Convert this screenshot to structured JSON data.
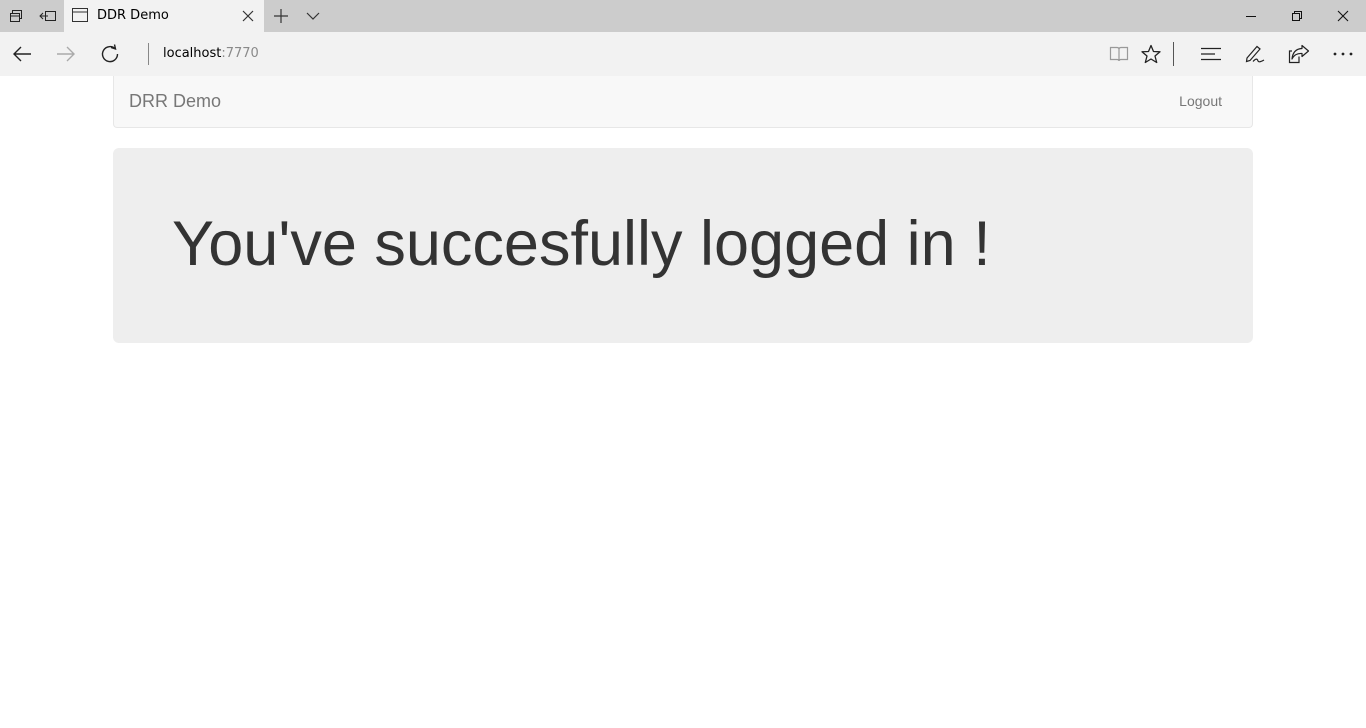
{
  "browser": {
    "tab": {
      "title": "DDR Demo"
    },
    "address": {
      "host": "localhost",
      "port": ":7770"
    }
  },
  "page": {
    "navbar": {
      "brand": "DRR Demo",
      "logout_label": "Logout"
    },
    "jumbotron": {
      "heading": "You've succesfully logged in !"
    }
  },
  "colors": {
    "tabstrip": "#cccccc",
    "chrome": "#f2f2f2",
    "navbar_bg": "#f8f8f8",
    "jumbotron_bg": "#eeeeee",
    "heading_text": "#333333",
    "muted_text": "#777777"
  },
  "icons": {
    "tab_strip_left": [
      "tab-previews-icon",
      "set-aside-tabs-icon"
    ],
    "tab": [
      "page-favicon-icon",
      "close-icon"
    ],
    "tab_strip_after": [
      "new-tab-plus-icon",
      "tab-list-chevron-icon"
    ],
    "window": [
      "minimize-icon",
      "restore-icon",
      "window-close-icon"
    ],
    "navigation": [
      "back-arrow-icon",
      "forward-arrow-icon",
      "refresh-icon"
    ],
    "toolbar": [
      "reading-view-icon",
      "favorite-star-icon",
      "hub-icon",
      "web-note-pen-icon",
      "share-icon",
      "more-dots-icon"
    ]
  }
}
